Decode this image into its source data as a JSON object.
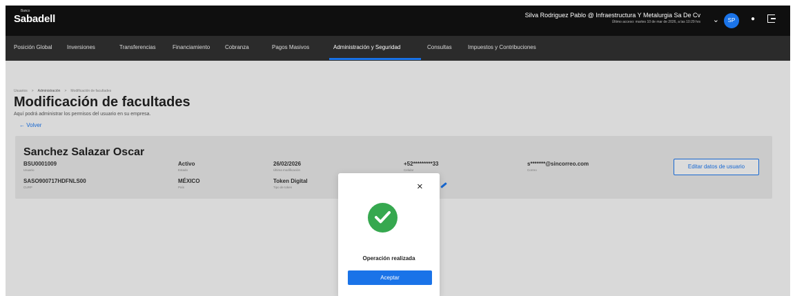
{
  "header": {
    "brand_sup": "Banco",
    "brand": "Sabadell",
    "user_name": "Silva Rodriguez Pablo @ Infraestructura Y Metalurgia Sa De Cv",
    "last_access": "Último acceso: martes 10 de mar de 2026, a las 10:29 hrs",
    "avatar_initials": "SP",
    "icons": [
      "chevron-down-icon",
      "bell-icon",
      "logout-icon"
    ]
  },
  "nav": {
    "items": [
      {
        "label": "Posición Global"
      },
      {
        "label": "Inversiones"
      },
      {
        "label": "Transferencias"
      },
      {
        "label": "Financiamiento"
      },
      {
        "label": "Cobranza"
      },
      {
        "label": "Pagos Masivos"
      },
      {
        "label": "Administración y Seguridad",
        "active": true
      },
      {
        "label": "Consultas"
      },
      {
        "label": "Impuestos y Contribuciones"
      }
    ],
    "accent": "#1a73e8"
  },
  "breadcrumb": {
    "items": [
      "Usuarios",
      "Administración",
      "Modificación de facultades"
    ]
  },
  "page": {
    "title": "Modificación de facultades",
    "subtitle": "Aquí podrá administrar los permisos del usuario en su empresa.",
    "back": "← Volver"
  },
  "user_card": {
    "name": "Sanchez Salazar Oscar",
    "fields": [
      {
        "value": "BSU0001009",
        "label": "Usuario"
      },
      {
        "value": "SASO900717HDFNLS00",
        "label": "CURP"
      },
      {
        "value": "Activo",
        "label": "Estado"
      },
      {
        "value": "MÉXICO",
        "label": "País"
      },
      {
        "value": "26/02/2026",
        "label": "Última modificación"
      },
      {
        "value": "Token Digital",
        "label": "Tipo de token"
      },
      {
        "value": "+52*********33",
        "label": "Celular"
      },
      {
        "value": "s*******@sincorreo.com",
        "label": "Correo"
      }
    ],
    "edit_button": "Editar datos de usuario"
  },
  "modal": {
    "message": "Operación realizada",
    "button": "Aceptar",
    "close": "×",
    "success_color": "#36a84f"
  }
}
